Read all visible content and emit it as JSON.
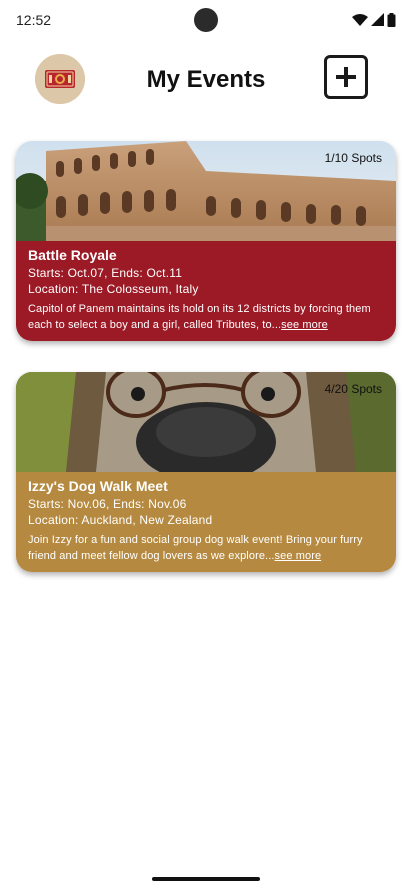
{
  "status_bar": {
    "time": "12:52",
    "icons": [
      "wifi-icon",
      "signal-icon",
      "battery-icon"
    ]
  },
  "header": {
    "title": "My Events",
    "avatar_icon": "ticket-icon",
    "add_icon": "plus-square-icon"
  },
  "events": [
    {
      "name": "Battle Royale",
      "spots": "1/10 Spots",
      "dates": "Starts: Oct.07, Ends: Oct.11",
      "location": "Location: The Colosseum, Italy",
      "description": "Capitol of Panem maintains its hold on its 12 districts by forcing them each to select a boy and a girl, called Tributes, to...",
      "see_more": "see more",
      "color": "#9b1a26"
    },
    {
      "name": "Izzy's Dog Walk Meet",
      "spots": "4/20 Spots",
      "dates": "Starts: Nov.06, Ends: Nov.06",
      "location": "Location: Auckland, New Zealand",
      "description": "Join Izzy for a fun and social group dog walk event! Bring your furry friend and meet fellow dog lovers as we explore...",
      "see_more": "see more",
      "color": "#b5893f"
    }
  ]
}
